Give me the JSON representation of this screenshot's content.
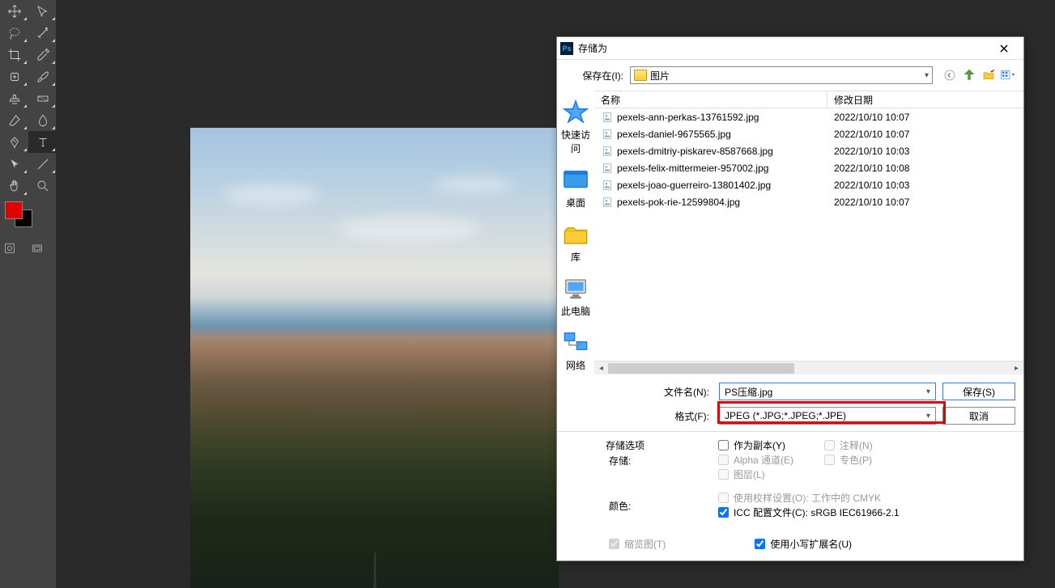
{
  "dialog": {
    "title": "存储为",
    "save_in_label": "保存在(I):",
    "save_in_value": "图片",
    "columns": {
      "name": "名称",
      "date": "修改日期"
    },
    "files": [
      {
        "name": "pexels-ann-perkas-13761592.jpg",
        "date": "2022/10/10 10:07"
      },
      {
        "name": "pexels-daniel-9675565.jpg",
        "date": "2022/10/10 10:07"
      },
      {
        "name": "pexels-dmitriy-piskarev-8587668.jpg",
        "date": "2022/10/10 10:03"
      },
      {
        "name": "pexels-felix-mittermeier-957002.jpg",
        "date": "2022/10/10 10:08"
      },
      {
        "name": "pexels-joao-guerreiro-13801402.jpg",
        "date": "2022/10/10 10:03"
      },
      {
        "name": "pexels-pok-rie-12599804.jpg",
        "date": "2022/10/10 10:07"
      }
    ],
    "filename_label": "文件名(N):",
    "filename_value": "PS压缩.jpg",
    "format_label": "格式(F):",
    "format_value": "JPEG (*.JPG;*.JPEG;*.JPE)",
    "save_btn": "保存(S)",
    "cancel_btn": "取消",
    "sidebar": [
      {
        "key": "quick",
        "label": "快速访问"
      },
      {
        "key": "desktop",
        "label": "桌面"
      },
      {
        "key": "library",
        "label": "库"
      },
      {
        "key": "thispc",
        "label": "此电脑"
      },
      {
        "key": "network",
        "label": "网络"
      }
    ],
    "options": {
      "group_label": "存储选项",
      "store_label": "存储:",
      "as_copy": "作为副本(Y)",
      "alpha": "Alpha 通道(E)",
      "layers": "图层(L)",
      "annotations": "注释(N)",
      "spot": "专色(P)",
      "color_label": "颜色:",
      "use_proof": "使用校样设置(O):  工作中的 CMYK",
      "icc_profile": "ICC 配置文件(C):  sRGB IEC61966-2.1",
      "thumbnail": "缩览图(T)",
      "lowercase_ext": "使用小写扩展名(U)"
    }
  }
}
